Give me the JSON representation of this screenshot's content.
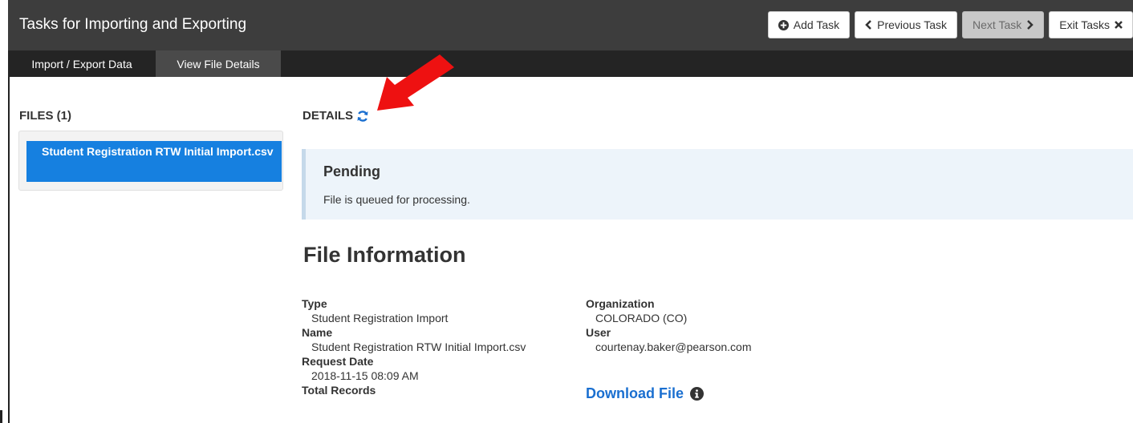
{
  "header": {
    "title": "Tasks for Importing and Exporting",
    "buttons": {
      "add_task": "Add Task",
      "previous_task": "Previous Task",
      "next_task": "Next Task",
      "exit_tasks": "Exit Tasks"
    }
  },
  "tabs": [
    {
      "label": "Import / Export Data",
      "active": false
    },
    {
      "label": "View File Details",
      "active": true
    }
  ],
  "files": {
    "heading": "FILES (1)",
    "items": [
      {
        "name": "Student Registration RTW Initial Import.csv",
        "selected": true
      }
    ]
  },
  "details": {
    "heading": "DETAILS",
    "status": {
      "title": "Pending",
      "message": "File is queued for processing."
    }
  },
  "file_info": {
    "heading": "File Information",
    "fields_left": [
      {
        "label": "Type",
        "value": "Student Registration Import"
      },
      {
        "label": "Name",
        "value": "Student Registration RTW Initial Import.csv"
      },
      {
        "label": "Request Date",
        "value": "2018-11-15 08:09 AM"
      },
      {
        "label": "Total Records",
        "value": ""
      }
    ],
    "fields_right": [
      {
        "label": "Organization",
        "value": "COLORADO (CO)"
      },
      {
        "label": "User",
        "value": "courtenay.baker@pearson.com"
      }
    ],
    "download_label": "Download File"
  },
  "colors": {
    "topbar": "#3d3d3d",
    "tabbar": "#242424",
    "active_tab": "#4a4a4a",
    "selected_file": "#1680e0",
    "link": "#1a6fd0",
    "pending_bg": "#edf4fa",
    "annotation_arrow": "#ee1111"
  },
  "icons": {
    "add": "plus-circle-icon",
    "previous": "chevron-left-icon",
    "next": "chevron-right-icon",
    "exit": "close-icon",
    "refresh": "refresh-icon",
    "info": "info-circle-icon"
  }
}
